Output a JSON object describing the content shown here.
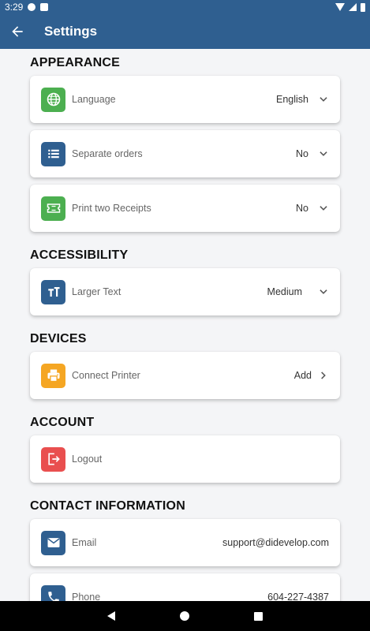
{
  "status_bar": {
    "time": "3:29"
  },
  "app_bar": {
    "title": "Settings"
  },
  "sections": {
    "appearance": {
      "title": "APPEARANCE",
      "language": {
        "label": "Language",
        "value": "English",
        "icon": "globe-icon",
        "icon_color": "#4caf50"
      },
      "separate_orders": {
        "label": "Separate orders",
        "value": "No",
        "icon": "list-icon",
        "icon_color": "#2f5f90"
      },
      "print_two_receipts": {
        "label": "Print two Receipts",
        "value": "No",
        "icon": "ticket-icon",
        "icon_color": "#4caf50"
      }
    },
    "accessibility": {
      "title": "ACCESSIBILITY",
      "larger_text": {
        "label": "Larger Text",
        "value": "Medium",
        "icon": "text-size-icon",
        "icon_color": "#2f5f90"
      }
    },
    "devices": {
      "title": "DEVICES",
      "connect_printer": {
        "label": "Connect Printer",
        "value": "Add",
        "icon": "printer-icon",
        "icon_color": "#f5a623"
      }
    },
    "account": {
      "title": "ACCOUNT",
      "logout": {
        "label": "Logout",
        "icon": "logout-icon",
        "icon_color": "#e94f4f"
      }
    },
    "contact": {
      "title": "CONTACT INFORMATION",
      "email": {
        "label": "Email",
        "value": "support@didevelop.com",
        "icon": "mail-icon",
        "icon_color": "#2f5f90"
      },
      "phone": {
        "label": "Phone",
        "value": "604-227-4387",
        "icon": "phone-icon",
        "icon_color": "#2f5f90"
      }
    }
  },
  "colors": {
    "primary": "#2f5f90",
    "background": "#f4f5f7"
  }
}
